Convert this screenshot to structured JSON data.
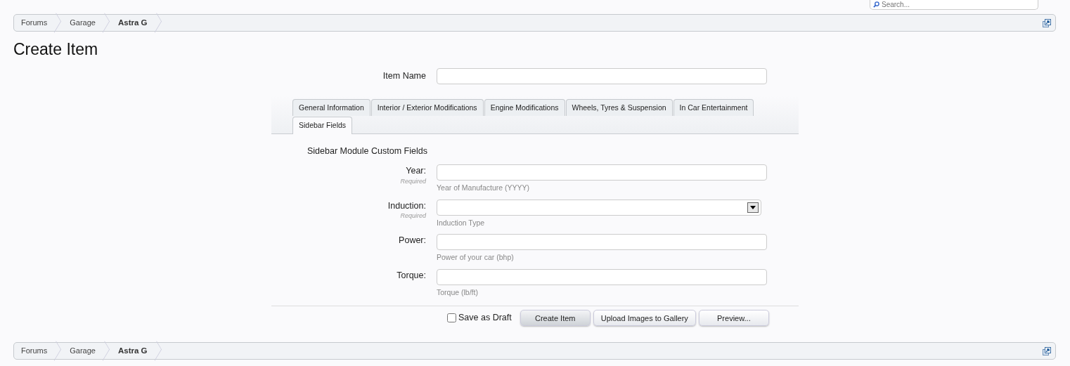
{
  "search": {
    "placeholder": "Search..."
  },
  "breadcrumb_top": [
    {
      "label": "Forums",
      "current": false
    },
    {
      "label": "Garage",
      "current": false
    },
    {
      "label": "Astra G",
      "current": true
    }
  ],
  "title": "Create Item",
  "item_name": {
    "label": "Item Name"
  },
  "tabs": [
    {
      "label": "General Information",
      "selected": false
    },
    {
      "label": "Interior / Exterior Modifications",
      "selected": false
    },
    {
      "label": "Engine Modifications",
      "selected": false
    },
    {
      "label": "Wheels, Tyres & Suspension",
      "selected": false
    },
    {
      "label": "In Car Entertainment",
      "selected": false
    },
    {
      "label": "Sidebar Fields",
      "selected": true
    }
  ],
  "section_heading": "Sidebar Module Custom Fields",
  "fields": [
    {
      "kind": "text",
      "label": "Year:",
      "required_text": "Required",
      "hint": "Year of Manufacture (YYYY)"
    },
    {
      "kind": "select",
      "label": "Induction:",
      "required_text": "Required",
      "hint": "Induction Type"
    },
    {
      "kind": "text",
      "label": "Power:",
      "hint": "Power of your car (bhp)"
    },
    {
      "kind": "text",
      "label": "Torque:",
      "hint": "Torque (lb/ft)"
    }
  ],
  "draft": {
    "label": "Save as Draft",
    "checked": false
  },
  "buttons": [
    {
      "label": "Create Item",
      "primary": true
    },
    {
      "label": "Upload Images to Gallery",
      "primary": false
    },
    {
      "label": "Preview...",
      "primary": false
    }
  ],
  "breadcrumb_bottom": [
    {
      "label": "Forums",
      "current": false
    },
    {
      "label": "Garage",
      "current": false
    },
    {
      "label": "Astra G",
      "current": true
    }
  ]
}
